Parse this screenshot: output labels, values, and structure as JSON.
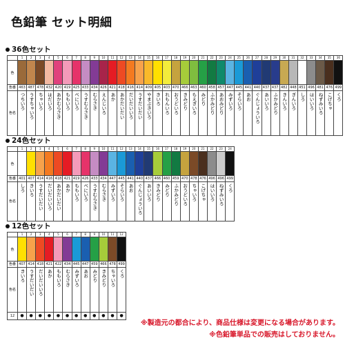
{
  "title": "色鉛筆 セット明細",
  "labels": {
    "color": "色",
    "code": "色番",
    "name": "色名"
  },
  "set36": {
    "heading": "36色セット",
    "items": [
      {
        "n": "1",
        "code": "463",
        "name": "つちいろ",
        "hex": "#9a6a3a"
      },
      {
        "n": "2",
        "code": "487",
        "name": "うすちゃいろ",
        "hex": "#c1864d"
      },
      {
        "n": "3",
        "code": "478",
        "name": "ちゃいろ",
        "hex": "#7b4a27"
      },
      {
        "n": "4",
        "code": "432",
        "name": "はだいろ",
        "hex": "#f3b9a2"
      },
      {
        "n": "5",
        "code": "420",
        "name": "あかむらさき",
        "hex": "#e0417d"
      },
      {
        "n": "6",
        "code": "419",
        "name": "ももいろ",
        "hex": "#f49ab9"
      },
      {
        "n": "7",
        "code": "425",
        "name": "べにいろ",
        "hex": "#e6336a"
      },
      {
        "n": "8",
        "code": "433",
        "name": "うすむらさき",
        "hex": "#c58cc3"
      },
      {
        "n": "9",
        "code": "434",
        "name": "むらさき",
        "hex": "#833b95"
      },
      {
        "n": "10",
        "code": "426",
        "name": "えんじいろ",
        "hex": "#a8244a"
      },
      {
        "n": "11",
        "code": "421",
        "name": "あか",
        "hex": "#e51c24"
      },
      {
        "n": "12",
        "code": "418",
        "name": "あかだいだい",
        "hex": "#ee4a23"
      },
      {
        "n": "13",
        "code": "416",
        "name": "だいだいいろ",
        "hex": "#f47a20"
      },
      {
        "n": "14",
        "code": "414",
        "name": "うすだいだい",
        "hex": "#f7a24b"
      },
      {
        "n": "15",
        "code": "409",
        "name": "やまぶきいろ",
        "hex": "#f9b92a"
      },
      {
        "n": "16",
        "code": "405",
        "name": "きいろ",
        "hex": "#ffe000"
      },
      {
        "n": "17",
        "code": "403",
        "name": "れもんいろ",
        "hex": "#f3ec3b"
      },
      {
        "n": "18",
        "code": "470",
        "name": "おうどいろ",
        "hex": "#c5a33e"
      },
      {
        "n": "19",
        "code": "466",
        "name": "きみどり",
        "hex": "#a6cc3a"
      },
      {
        "n": "20",
        "code": "463",
        "name": "もえぎいろ",
        "hex": "#7fbd3f"
      },
      {
        "n": "21",
        "code": "460",
        "name": "みどり",
        "hex": "#25a046"
      },
      {
        "n": "22",
        "code": "458",
        "name": "ふかみどり",
        "hex": "#127a42"
      },
      {
        "n": "23",
        "code": "457",
        "name": "あおみどり",
        "hex": "#0f8a6b"
      },
      {
        "n": "24",
        "code": "447",
        "name": "みずいろ",
        "hex": "#5ab4e3"
      },
      {
        "n": "25",
        "code": "445",
        "name": "そらいろ",
        "hex": "#1a9ad7"
      },
      {
        "n": "26",
        "code": "441",
        "name": "あお",
        "hex": "#1a5fb0"
      },
      {
        "n": "27",
        "code": "440",
        "name": "ぐんじょういろ",
        "hex": "#1f3f99"
      },
      {
        "n": "28",
        "code": "437",
        "name": "あいいろ",
        "hex": "#213a74"
      },
      {
        "n": "29",
        "code": "437",
        "name": "ふかみどり",
        "hex": "#283c8c"
      },
      {
        "n": "30",
        "code": "482",
        "name": "きんいろ",
        "hex": "#c8a952"
      },
      {
        "n": "31",
        "code": "448",
        "name": "ぎんいろ",
        "hex": "#b7b7b7"
      },
      {
        "n": "32",
        "code": "451",
        "name": "しろ",
        "hex": "#ffffff"
      },
      {
        "n": "33",
        "code": "496",
        "name": "はいいろ",
        "hex": "#8c8c8c"
      },
      {
        "n": "34",
        "code": "481",
        "name": "ねずみいろ",
        "hex": "#6b5a48"
      },
      {
        "n": "35",
        "code": "476",
        "name": "こげちゃ",
        "hex": "#4a2f1e"
      },
      {
        "n": "36",
        "code": "499",
        "name": "くろ",
        "hex": "#111111"
      }
    ]
  },
  "set24": {
    "heading": "24色セット",
    "items": [
      {
        "n": "1",
        "code": "401",
        "name": "しろ",
        "hex": "#ffffff"
      },
      {
        "n": "2",
        "code": "407",
        "name": "きいろ",
        "hex": "#ffe000"
      },
      {
        "n": "3",
        "code": "414",
        "name": "うすだいだい",
        "hex": "#f7a24b"
      },
      {
        "n": "4",
        "code": "416",
        "name": "だいだいいろ",
        "hex": "#f47a20"
      },
      {
        "n": "5",
        "code": "418",
        "name": "あかだいだい",
        "hex": "#ee4a23"
      },
      {
        "n": "6",
        "code": "421",
        "name": "あか",
        "hex": "#e51c24"
      },
      {
        "n": "7",
        "code": "419",
        "name": "ももいろ",
        "hex": "#f49ab9"
      },
      {
        "n": "8",
        "code": "426",
        "name": "べにいろ",
        "hex": "#e6336a"
      },
      {
        "n": "9",
        "code": "433",
        "name": "うすむらさき",
        "hex": "#c58cc3"
      },
      {
        "n": "10",
        "code": "434",
        "name": "むらさき",
        "hex": "#833b95"
      },
      {
        "n": "11",
        "code": "447",
        "name": "みずいろ",
        "hex": "#5ab4e3"
      },
      {
        "n": "12",
        "code": "445",
        "name": "そらいろ",
        "hex": "#1a9ad7"
      },
      {
        "n": "13",
        "code": "441",
        "name": "あお",
        "hex": "#1a5fb0"
      },
      {
        "n": "14",
        "code": "440",
        "name": "ぐんじょういろ",
        "hex": "#1f3f99"
      },
      {
        "n": "15",
        "code": "437",
        "name": "あいいろ",
        "hex": "#213a74"
      },
      {
        "n": "16",
        "code": "466",
        "name": "きみどり",
        "hex": "#a6cc3a"
      },
      {
        "n": "17",
        "code": "460",
        "name": "みどり",
        "hex": "#25a046"
      },
      {
        "n": "18",
        "code": "459",
        "name": "ふかみどり",
        "hex": "#127a42"
      },
      {
        "n": "19",
        "code": "470",
        "name": "おうどいろ",
        "hex": "#c5a33e"
      },
      {
        "n": "20",
        "code": "478",
        "name": "ちゃいろ",
        "hex": "#7b4a27"
      },
      {
        "n": "21",
        "code": "476",
        "name": "こげちゃ",
        "hex": "#4a2f1e"
      },
      {
        "n": "22",
        "code": "496",
        "name": "はいいろ",
        "hex": "#8c8c8c"
      },
      {
        "n": "23",
        "code": "496",
        "name": "ねずみいろ",
        "hex": "#cccccc"
      },
      {
        "n": "24",
        "code": "499",
        "name": "くろ",
        "hex": "#111111"
      }
    ]
  },
  "set12": {
    "heading": "12色セット",
    "items": [
      {
        "n": "1",
        "code": "407",
        "name": "きいろ",
        "hex": "#ffe000"
      },
      {
        "n": "2",
        "code": "414",
        "name": "うすだいだい",
        "hex": "#f7a24b"
      },
      {
        "n": "3",
        "code": "418",
        "name": "だいだいいろ",
        "hex": "#ee4a23"
      },
      {
        "n": "4",
        "code": "421",
        "name": "あか",
        "hex": "#e51c24"
      },
      {
        "n": "5",
        "code": "422",
        "name": "ももいろ",
        "hex": "#f49ab9"
      },
      {
        "n": "6",
        "code": "434",
        "name": "むらさき",
        "hex": "#833b95"
      },
      {
        "n": "7",
        "code": "445",
        "name": "みずいろ",
        "hex": "#1a9ad7"
      },
      {
        "n": "8",
        "code": "447",
        "name": "あお",
        "hex": "#1a5fb0"
      },
      {
        "n": "9",
        "code": "459",
        "name": "みどり",
        "hex": "#25a046"
      },
      {
        "n": "10",
        "code": "466",
        "name": "きみどり",
        "hex": "#a6cc3a"
      },
      {
        "n": "11",
        "code": "478",
        "name": "ちゃいろ",
        "hex": "#7b4a27"
      },
      {
        "n": "12",
        "code": "499",
        "name": "くろ",
        "hex": "#111111"
      }
    ],
    "check_label": "12",
    "check_mark": "●"
  },
  "notes": [
    "※製造元の都合により、商品仕様は変更になる場合があります。",
    "※色鉛筆単品での販売はしておりません。"
  ]
}
